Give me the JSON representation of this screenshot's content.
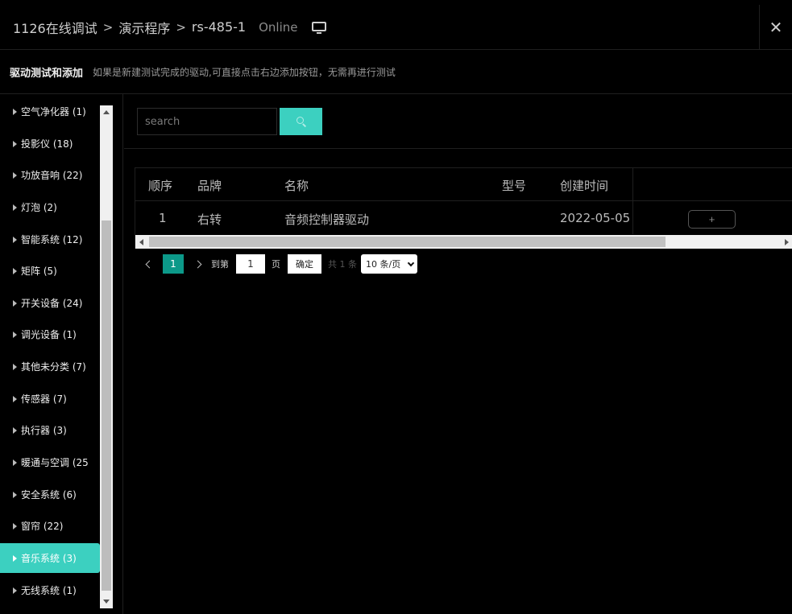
{
  "header": {
    "breadcrumb": [
      "1126在线调试",
      "演示程序",
      "rs-485-1"
    ],
    "status": "Online",
    "monitor_icon": "monitor-icon",
    "close_label": "✕"
  },
  "subheader": {
    "title": "驱动测试和添加",
    "hint": "如果是新建测试完成的驱动,可直接点击右边添加按钮，无需再进行测试"
  },
  "sidebar": {
    "categories": [
      "空气净化器 (1)",
      "投影仪 (18)",
      "功放音响 (22)",
      "灯泡 (2)",
      "智能系统 (12)",
      "矩阵 (5)",
      "开关设备 (24)",
      "调光设备 (1)",
      "其他未分类 (7)",
      "传感器 (7)",
      "执行器 (3)",
      "暖通与空调 (25",
      "安全系统 (6)",
      "窗帘 (22)",
      "音乐系统 (3)",
      "无线系统 (1)"
    ],
    "active_index": 14,
    "active_color": "#3cd0c0"
  },
  "search": {
    "placeholder": "search",
    "button_color": "#3cd0c0"
  },
  "table": {
    "headers": [
      "顺序",
      "品牌",
      "名称",
      "型号",
      "创建时间"
    ],
    "rows": [
      {
        "order": "1",
        "brand": "右转",
        "name": "音频控制器驱动",
        "model": "",
        "created": "2022-05-05",
        "action": "+"
      }
    ]
  },
  "pagination": {
    "current_page": "1",
    "goto_label": "到第",
    "goto_value": "1",
    "page_unit": "页",
    "confirm_label": "确定",
    "total": "共 1 条",
    "page_size": "10 条/页",
    "accent_color": "#0c9989"
  }
}
